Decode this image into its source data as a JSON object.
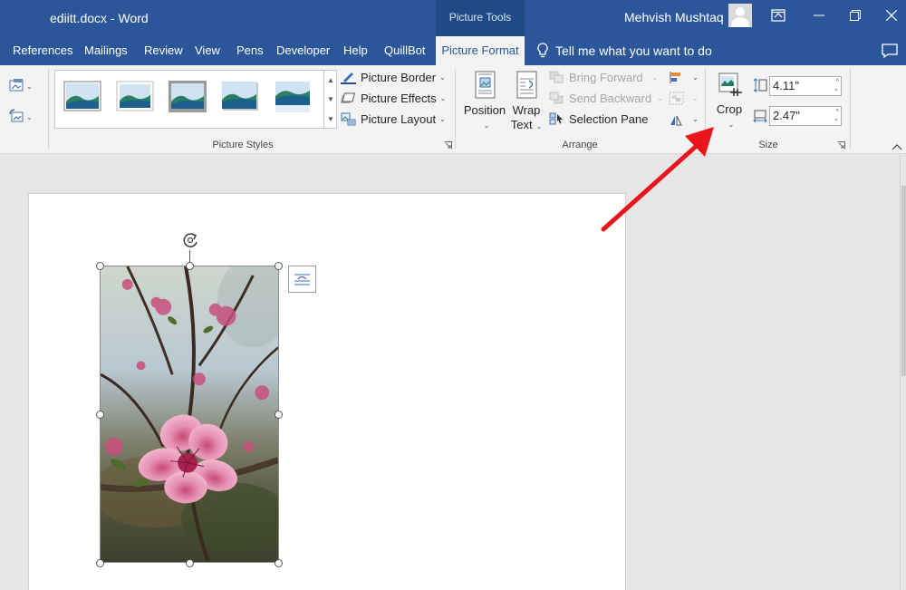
{
  "titlebar": {
    "document_title": "ediitt.docx  -  Word",
    "contextual_tab_group": "Picture Tools",
    "user_name": "Mehvish Mushtaq"
  },
  "tabs": [
    {
      "label": "References"
    },
    {
      "label": "Mailings"
    },
    {
      "label": "Review"
    },
    {
      "label": "View"
    },
    {
      "label": "Pens"
    },
    {
      "label": "Developer"
    },
    {
      "label": "Help"
    },
    {
      "label": "QuillBot"
    },
    {
      "label": "Picture Format",
      "active": true
    }
  ],
  "tell_me": "Tell me what you want to do",
  "ribbon": {
    "picture_styles": {
      "label": "Picture Styles",
      "commands": {
        "border": "Picture Border",
        "effects": "Picture Effects",
        "layout": "Picture Layout"
      }
    },
    "arrange": {
      "label": "Arrange",
      "position": "Position",
      "wrap_line1": "Wrap",
      "wrap_line2": "Text",
      "bring_forward": "Bring Forward",
      "send_backward": "Send Backward",
      "selection_pane": "Selection Pane"
    },
    "size": {
      "label": "Size",
      "crop": "Crop",
      "height": "4.11\"",
      "width": "2.47\""
    }
  },
  "colors": {
    "titlebar": "#2b579a",
    "contextual_header": "#1f4a86",
    "ribbon_bg": "#f3f3f3",
    "annotation_arrow": "#e8161c"
  }
}
